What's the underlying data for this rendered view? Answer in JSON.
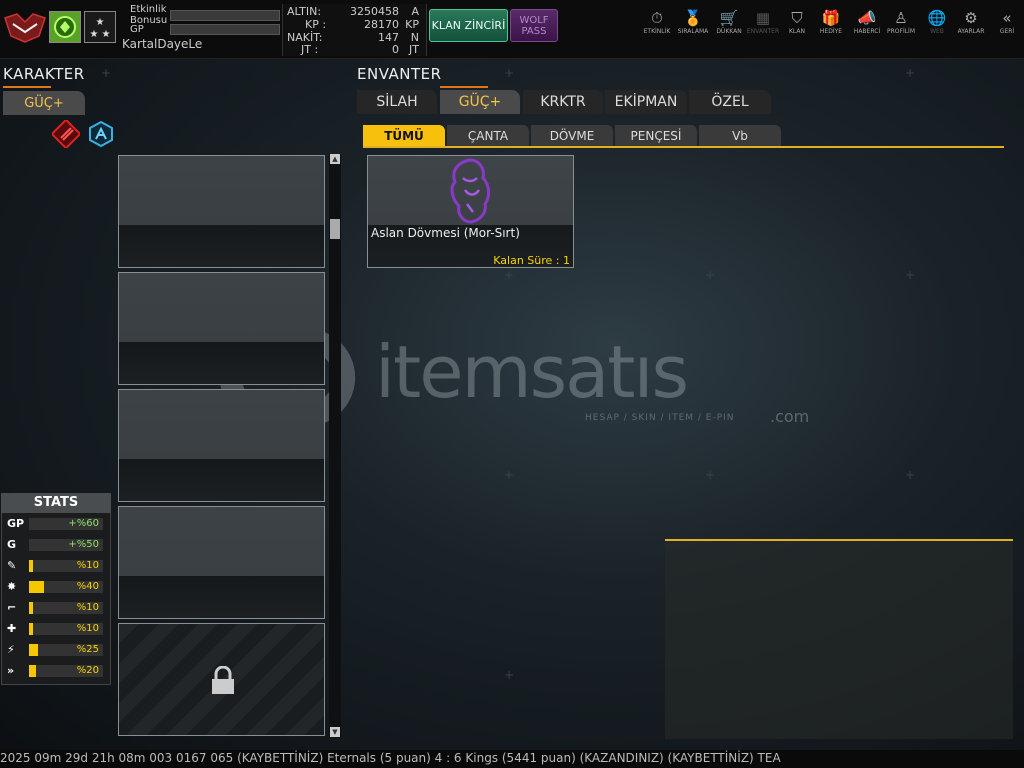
{
  "header": {
    "event_bonus_label": "Etkinlik\nBonusu",
    "gp_label": "GP",
    "username": "KartalDayeLe",
    "currency": [
      {
        "key": "ALTIN:",
        "value": "3250458",
        "unit": "A"
      },
      {
        "key": "KP :",
        "value": "28170",
        "unit": "KP"
      },
      {
        "key": "NAKİT:",
        "value": "147",
        "unit": "N"
      },
      {
        "key": "JT :",
        "value": "0",
        "unit": "JT"
      }
    ],
    "klan_chain_label": "KLAN ZİNCİRİ",
    "wolf_pass_label": "WOLF\nPASS",
    "nav": [
      {
        "label": "ETKİNLİK",
        "icon": "stopwatch-icon",
        "glyph": "⏱"
      },
      {
        "label": "SIRALAMA",
        "icon": "medal-icon",
        "glyph": "🏅"
      },
      {
        "label": "DÜKKAN",
        "icon": "cart-icon",
        "glyph": "🛒"
      },
      {
        "label": "ENVANTER",
        "icon": "inventory-icon",
        "glyph": "▦"
      },
      {
        "label": "KLAN",
        "icon": "shield-icon",
        "glyph": "⛉"
      },
      {
        "label": "HEDİYE",
        "icon": "gift-icon",
        "glyph": "🎁"
      },
      {
        "label": "HABERCİ",
        "icon": "megaphone-icon",
        "glyph": "📣"
      },
      {
        "label": "PROFİLİM",
        "icon": "user-icon",
        "glyph": "♙"
      },
      {
        "label": "WEB",
        "icon": "globe-icon",
        "glyph": "🌐"
      },
      {
        "label": "AYARLAR",
        "icon": "gear-icon",
        "glyph": "⚙"
      },
      {
        "label": "GERİ",
        "icon": "back-icon",
        "glyph": "«"
      }
    ]
  },
  "character": {
    "title": "KARAKTER",
    "tab_label": "GÜÇ+"
  },
  "stats": {
    "title": "STATS",
    "rows": [
      {
        "icon": "gp-icon",
        "glyph": "GP",
        "value": "+%60",
        "fill": 0,
        "color": "#8fe06a"
      },
      {
        "icon": "gold-icon",
        "glyph": "G",
        "value": "+%50",
        "fill": 0,
        "color": "#8fe06a"
      },
      {
        "icon": "weapon-icon",
        "glyph": "✎",
        "value": "%10",
        "fill": 0.05,
        "color": "#f5d400"
      },
      {
        "icon": "explosion-icon",
        "glyph": "✸",
        "value": "%40",
        "fill": 0.2,
        "color": "#f5d400"
      },
      {
        "icon": "gun-icon",
        "glyph": "⌐",
        "value": "%10",
        "fill": 0.05,
        "color": "#f5d400"
      },
      {
        "icon": "health-icon",
        "glyph": "✚",
        "value": "%10",
        "fill": 0.05,
        "color": "#f5d400"
      },
      {
        "icon": "stamina-icon",
        "glyph": "⚡",
        "value": "%25",
        "fill": 0.12,
        "color": "#f5d400"
      },
      {
        "icon": "speed-icon",
        "glyph": "»",
        "value": "%20",
        "fill": 0.1,
        "color": "#f5d400"
      }
    ]
  },
  "inventory": {
    "title": "ENVANTER",
    "tabs": [
      "SİLAH",
      "GÜÇ+",
      "KRKTR",
      "EKİPMAN",
      "ÖZEL"
    ],
    "active_tab": 1,
    "subtabs": [
      "TÜMÜ",
      "ÇANTA",
      "DÖVME",
      "PENÇESİ",
      "Vb"
    ],
    "active_subtab": 0,
    "items": [
      {
        "name": "Aslan Dövmesi (Mor-Sırt)",
        "time_label": "Kalan Süre : 1"
      }
    ]
  },
  "watermark": {
    "brand": "itemsatıs",
    "tagline": "HESAP / SKIN / ITEM / E-PIN",
    "suffix": ".com"
  },
  "bottom_ticker": "2025 09m 29d 21h 08m 003 0167 065     (KAYBETTİNİZ) Eternals (5 puan) 4 : 6 Kings (5441 puan) (KAZANDINIZ)          (KAYBETTİNİZ) TEA"
}
